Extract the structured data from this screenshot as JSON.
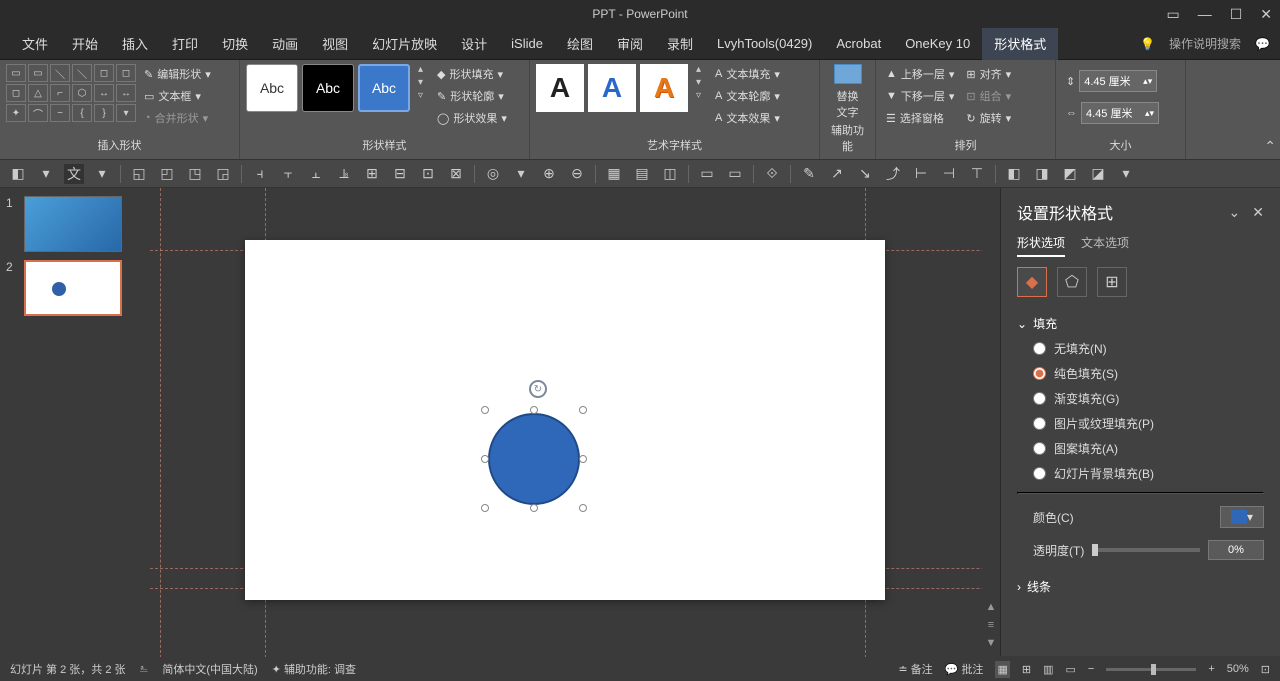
{
  "title": "PPT - PowerPoint",
  "tabs": [
    "文件",
    "开始",
    "插入",
    "打印",
    "切换",
    "动画",
    "视图",
    "幻灯片放映",
    "设计",
    "iSlide",
    "绘图",
    "审阅",
    "录制",
    "LvyhTools(0429)",
    "Acrobat",
    "OneKey 10",
    "形状格式"
  ],
  "active_tab": "形状格式",
  "tell_me": "操作说明搜索",
  "ribbon": {
    "insert_shape": {
      "label": "插入形状",
      "edit_shape": "编辑形状",
      "text_box": "文本框",
      "merge_shapes": "合并形状"
    },
    "shape_styles": {
      "label": "形状样式",
      "abc": "Abc",
      "fill": "形状填充",
      "outline": "形状轮廓",
      "effects": "形状效果"
    },
    "wordart": {
      "label": "艺术字样式",
      "text_fill": "文本填充",
      "text_outline": "文本轮廓",
      "text_effects": "文本效果",
      "glyph": "A"
    },
    "accessibility": {
      "label": "辅助功能",
      "alt_text": "替换\n文字"
    },
    "arrange": {
      "label": "排列",
      "bring_forward": "上移一层",
      "send_backward": "下移一层",
      "selection_pane": "选择窗格",
      "align": "对齐",
      "group": "组合",
      "rotate": "旋转"
    },
    "size": {
      "label": "大小",
      "height": "4.45 厘米",
      "width": "4.45 厘米"
    }
  },
  "thumbs": [
    {
      "n": "1"
    },
    {
      "n": "2"
    }
  ],
  "format_pane": {
    "title": "设置形状格式",
    "tab_shape": "形状选项",
    "tab_text": "文本选项",
    "fill_label": "填充",
    "line_label": "线条",
    "fill_options": {
      "none": "无填充(N)",
      "solid": "纯色填充(S)",
      "gradient": "渐变填充(G)",
      "picture": "图片或纹理填充(P)",
      "pattern": "图案填充(A)",
      "slide_bg": "幻灯片背景填充(B)"
    },
    "color_label": "颜色(C)",
    "transparency_label": "透明度(T)",
    "transparency_value": "0%"
  },
  "status": {
    "slide_info": "幻灯片 第 2 张，共 2 张",
    "lang": "简体中文(中国大陆)",
    "access": "辅助功能: 调查",
    "notes": "备注",
    "comments": "批注",
    "zoom": "50%"
  }
}
